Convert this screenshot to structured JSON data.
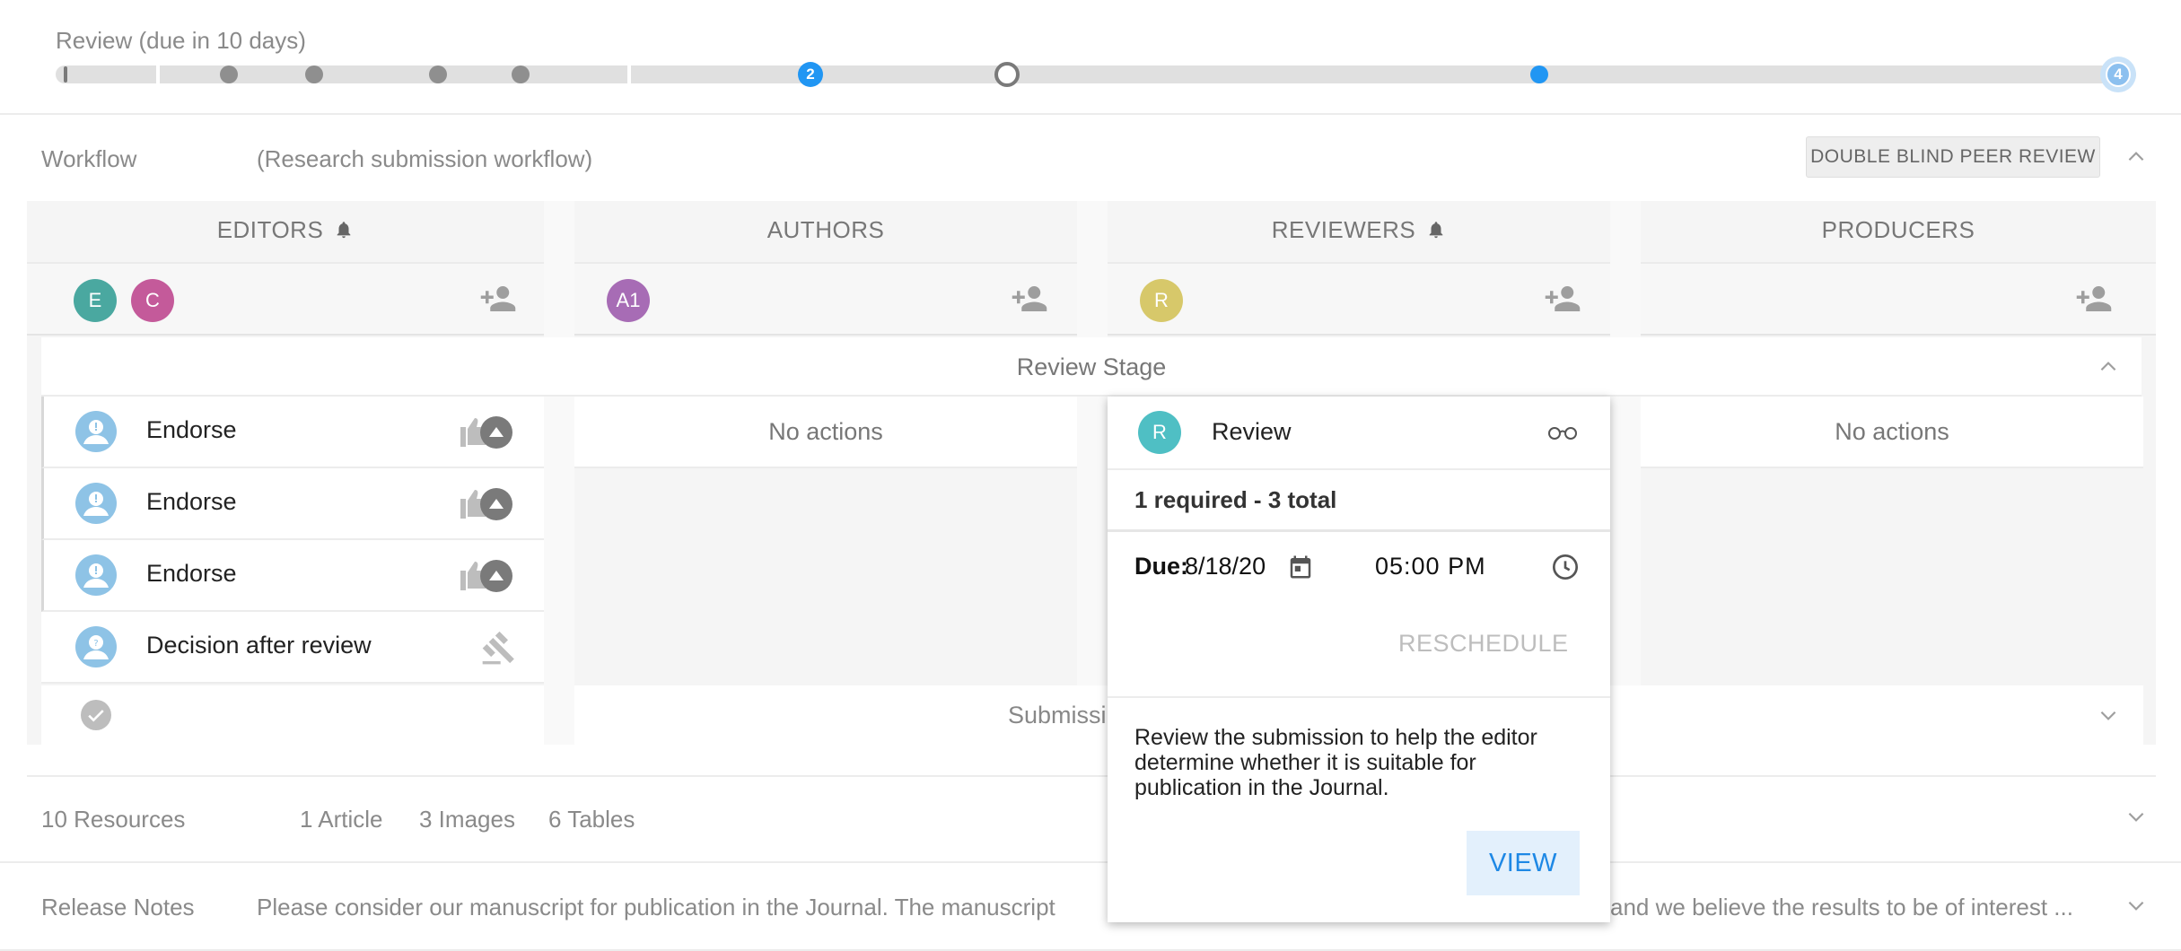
{
  "progress": {
    "title": "Review (due in 10 days)",
    "current_step": "2",
    "final_step": "4"
  },
  "workflow": {
    "label": "Workflow",
    "name": "(Research submission workflow)",
    "badge": "DOUBLE BLIND PEER REVIEW"
  },
  "columns": [
    {
      "title": "EDITORS",
      "bell": true,
      "avatars": [
        {
          "initials": "E",
          "color": "#4aa8a0"
        },
        {
          "initials": "C",
          "color": "#c45a9a"
        }
      ]
    },
    {
      "title": "AUTHORS",
      "bell": false,
      "avatars": [
        {
          "initials": "A1",
          "color": "#a76cb5"
        }
      ]
    },
    {
      "title": "REVIEWERS",
      "bell": true,
      "avatars": [
        {
          "initials": "R",
          "color": "#d7c86a"
        }
      ]
    },
    {
      "title": "PRODUCERS",
      "bell": false,
      "avatars": []
    }
  ],
  "stage": {
    "title": "Review Stage",
    "next_stage": "Submissi",
    "editor_actions": [
      "Endorse",
      "Endorse",
      "Endorse",
      "Decision after review"
    ],
    "authors_actions": "No actions",
    "producers_actions": "No actions"
  },
  "review_card": {
    "avatar_initial": "R",
    "title": "Review",
    "count": "1 required - 3 total",
    "due_label": "Due:",
    "due_date": "8/18/20",
    "due_time": "05:00 PM",
    "reschedule": "RESCHEDULE",
    "description": "Review the submission to help the editor determine whether it is suitable for publication in the Journal.",
    "view": "VIEW"
  },
  "resources": {
    "label": "10 Resources",
    "items": [
      "1 Article",
      "3 Images",
      "6 Tables"
    ]
  },
  "release_notes": {
    "label": "Release Notes",
    "text_left": "Please consider our manuscript for publication in the Journal. The manuscript",
    "text_right": "and we believe the results to be of interest ..."
  },
  "colors": {
    "accent": "#2196f3",
    "track": "#e0e0e0",
    "view_bg": "#e3f0fc"
  }
}
